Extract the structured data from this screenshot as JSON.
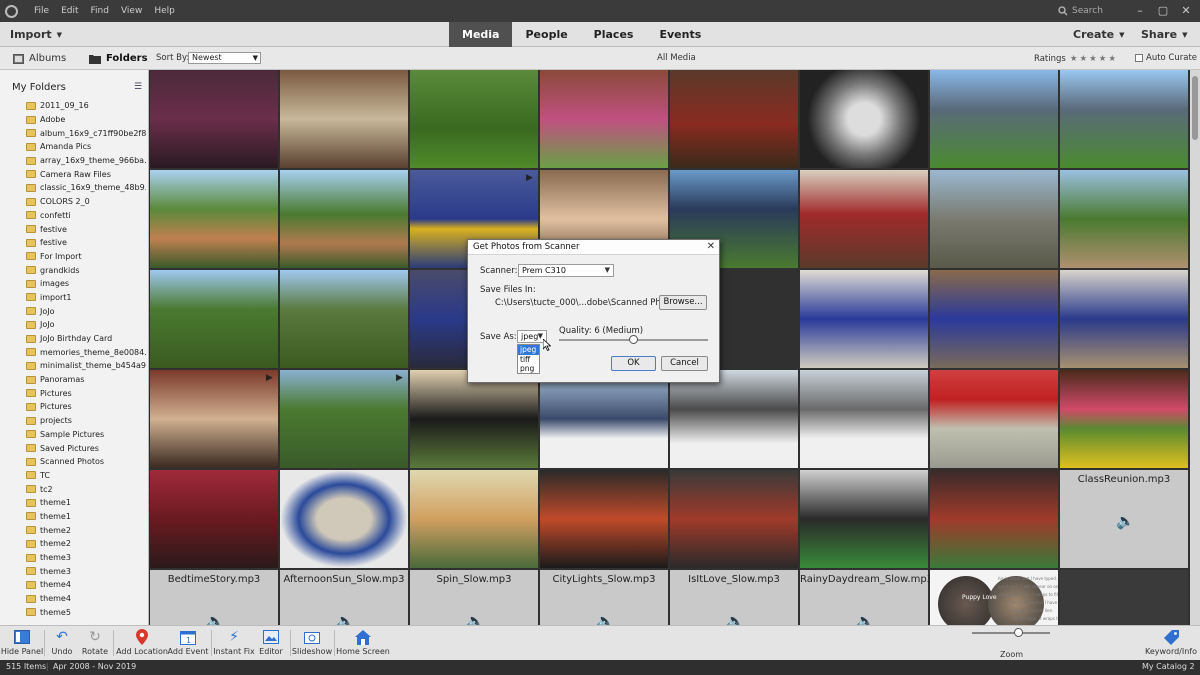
{
  "menubar": {
    "items": [
      "File",
      "Edit",
      "Find",
      "View",
      "Help"
    ],
    "search_label": "Search"
  },
  "topbar": {
    "import_label": "Import",
    "tabs": [
      {
        "label": "Media",
        "active": true
      },
      {
        "label": "People",
        "active": false
      },
      {
        "label": "Places",
        "active": false
      },
      {
        "label": "Events",
        "active": false
      }
    ],
    "create_label": "Create",
    "share_label": "Share"
  },
  "subbar": {
    "albums_label": "Albums",
    "folders_label": "Folders",
    "sort_label": "Sort By:",
    "sort_value": "Newest",
    "all_media_label": "All Media",
    "ratings_label": "Ratings",
    "auto_curate_label": "Auto Curate"
  },
  "sidebar": {
    "title": "My Folders",
    "folders": [
      "2011_09_16",
      "Adobe",
      "album_16x9_c71ff90be2f8...",
      "Amanda Pics",
      "array_16x9_theme_966ba...",
      "Camera Raw Files",
      "classic_16x9_theme_48b9...",
      "COLORS 2_0",
      "confetti",
      "festive",
      "festive",
      "For Import",
      "grandkids",
      "images",
      "import1",
      "JoJo",
      "JoJo",
      "JoJo Birthday Card",
      "memories_theme_8e0084...",
      "minimalist_theme_b454a9...",
      "Panoramas",
      "Pictures",
      "Pictures",
      "projects",
      "Sample Pictures",
      "Saved Pictures",
      "Scanned Photos",
      "TC",
      "tc2",
      "theme1",
      "theme1",
      "theme2",
      "theme2",
      "theme3",
      "theme3",
      "theme4",
      "theme4",
      "theme5"
    ]
  },
  "grid": {
    "audio_files": [
      "ClassReunion.mp3",
      "BedtimeStory.mp3",
      "AfternoonSun_Slow.mp3",
      "Spin_Slow.mp3",
      "CityLights_Slow.mp3",
      "IsItLove_Slow.mp3",
      "RainyDaydream_Slow.mp3"
    ],
    "card_title": "Puppy Love",
    "card_text_lines": [
      "his is some text I have typed.",
      "point text, it will appear on one line.",
      "paragraph type, it wraps to fit its bounding box.",
      "his is some text I have typed. If point text, it",
      "l appear on one line.",
      "agraph type, it wraps to fit"
    ]
  },
  "dialog": {
    "title": "Get Photos from Scanner",
    "scanner_label": "Scanner:",
    "scanner_value": "Prem C310",
    "save_files_label": "Save Files In:",
    "save_path": "C:\\Users\\tucte_000\\...dobe\\Scanned Photos",
    "browse_label": "Browse...",
    "save_as_label": "Save As:",
    "save_as_value": "jpeg",
    "format_options": [
      "jpeg",
      "tiff",
      "png"
    ],
    "quality_label": "Quality: 6 (Medium)",
    "ok_label": "OK",
    "cancel_label": "Cancel"
  },
  "toolbar": {
    "hide_panel": "Hide Panel",
    "undo": "Undo",
    "rotate": "Rotate",
    "add_location": "Add Location",
    "add_event": "Add Event",
    "instant_fix": "Instant Fix",
    "editor": "Editor",
    "slideshow": "Slideshow",
    "home_screen": "Home Screen",
    "zoom": "Zoom",
    "keyword_info": "Keyword/Info"
  },
  "status": {
    "items_count": "515 Items",
    "date_range": "Apr 2008 - Nov 2019",
    "catalog": "My Catalog 2"
  },
  "colors": {
    "accent_blue": "#3178d6",
    "active_tab": "#505050",
    "folder_yellow": "#e7c45a"
  }
}
